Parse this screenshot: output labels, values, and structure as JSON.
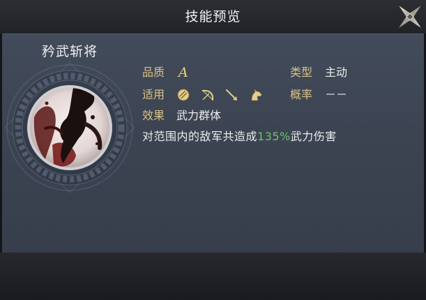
{
  "header": {
    "title": "技能预览",
    "close_icon": "close-icon"
  },
  "skill": {
    "name": "矜武斩将",
    "icon": "skill-emblem-icon"
  },
  "fields": {
    "quality": {
      "label": "品质",
      "value": "A"
    },
    "type": {
      "label": "类型",
      "value": "主动"
    },
    "applicable": {
      "label": "适用",
      "icons": [
        "shield-icon",
        "bow-icon",
        "spear-icon",
        "horse-icon"
      ]
    },
    "chance": {
      "label": "概率",
      "value": "－－"
    },
    "effect": {
      "label": "效果",
      "value": "武力群体"
    }
  },
  "description": {
    "prefix": "对范围内的敌军共造成",
    "highlight": "135%",
    "suffix": "武力伤害"
  },
  "colors": {
    "label": "#d9c284",
    "value": "#ececec",
    "highlight": "#6cc26e",
    "quality": "#e9d47a"
  }
}
